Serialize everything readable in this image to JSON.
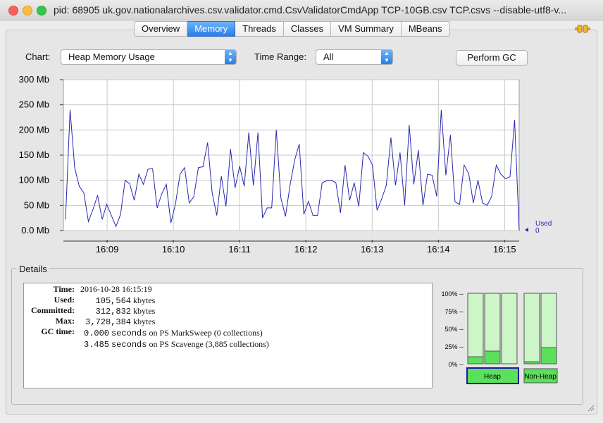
{
  "window": {
    "title": "pid: 68905 uk.gov.nationalarchives.csv.validator.cmd.CsvValidatorCmdApp TCP-10GB.csv TCP.csvs --disable-utf8-v..."
  },
  "tabs": [
    "Overview",
    "Memory",
    "Threads",
    "Classes",
    "VM Summary",
    "MBeans"
  ],
  "active_tab": "Memory",
  "controls": {
    "chart_label": "Chart:",
    "chart_value": "Heap Memory Usage",
    "range_label": "Time Range:",
    "range_value": "All",
    "gc_button": "Perform GC"
  },
  "chart_data": {
    "type": "line",
    "ylim": [
      0,
      300
    ],
    "y_ticks": [
      "0.0 Mb",
      "50 Mb",
      "100 Mb",
      "150 Mb",
      "200 Mb",
      "250 Mb",
      "300 Mb"
    ],
    "x_ticks": [
      "16:09",
      "16:10",
      "16:11",
      "16:12",
      "16:13",
      "16:14",
      "16:15"
    ],
    "x_range_minutes": [
      8.34,
      15.22
    ],
    "grid": true,
    "color": "#2828b0",
    "legend": {
      "name": "Used",
      "value": "0"
    },
    "series_values": [
      22,
      240,
      125,
      88,
      75,
      18,
      42,
      70,
      22,
      52,
      30,
      8,
      32,
      100,
      93,
      60,
      112,
      92,
      122,
      123,
      45,
      73,
      92,
      15,
      53,
      112,
      125,
      55,
      67,
      125,
      127,
      175,
      75,
      30,
      108,
      48,
      162,
      85,
      128,
      88,
      195,
      90,
      195,
      25,
      45,
      45,
      200,
      65,
      28,
      90,
      140,
      172,
      32,
      58,
      30,
      30,
      95,
      99,
      100,
      95,
      35,
      130,
      60,
      95,
      48,
      155,
      148,
      130,
      40,
      63,
      90,
      185,
      90,
      155,
      50,
      210,
      92,
      160,
      50,
      112,
      110,
      68,
      240,
      110,
      190,
      57,
      52,
      130,
      113,
      55,
      100,
      55,
      50,
      68,
      130,
      112,
      103,
      107,
      220,
      0
    ]
  },
  "details": {
    "title": "Details",
    "time_label": "Time:",
    "time_value": "2016-10-28 16:15:19",
    "used_label": "Used:",
    "used_value": "105,564",
    "used_unit": "kbytes",
    "committed_label": "Committed:",
    "committed_value": "312,832",
    "committed_unit": "kbytes",
    "max_label": "Max:",
    "max_value": "3,728,384",
    "max_unit": "kbytes",
    "gc_label": "GC time:",
    "gc1_value": "0.000",
    "gc1_unit": "seconds",
    "gc1_desc": "on PS MarkSweep (0 collections)",
    "gc2_value": "3.485",
    "gc2_unit": "seconds",
    "gc2_desc": "on PS Scavenge (3,885 collections)"
  },
  "pools": {
    "ticks": [
      "100% --",
      "75% --",
      "50% --",
      "25% --",
      "0% --"
    ],
    "heap_levels": [
      0.1,
      0.18,
      0.0
    ],
    "nonheap_levels": [
      0.03,
      0.23
    ],
    "heap_label": "Heap",
    "nonheap_label": "Non-Heap"
  }
}
